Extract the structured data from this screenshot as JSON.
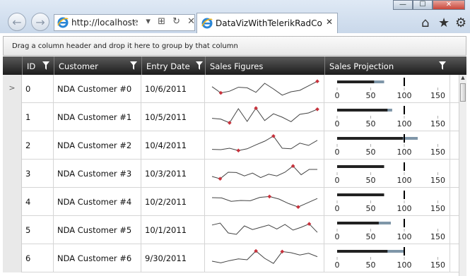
{
  "browser": {
    "address": "http://localhost:",
    "tab_title": "DataVizWithTelerikRadCont…",
    "back_glyph": "←",
    "forward_glyph": "→",
    "address_tools": "⌕ ▾ ⊞ ↻ ✕",
    "tab_close": "✕",
    "minimize": "—",
    "maximize": "☐",
    "close": "✕",
    "home_glyph": "⌂",
    "favorites_glyph": "★",
    "tools_glyph": "⚙",
    "ie_color": "#2a86d6"
  },
  "grid": {
    "group_panel_text": "Drag a column header and drop it here to group by that column",
    "headers": {
      "id": "ID",
      "customer": "Customer",
      "entry_date": "Entry Date",
      "sales_figures": "Sales Figures",
      "sales_projection": "Sales Projection"
    },
    "current_row_indicator": ">",
    "bullet_ticks": [
      "0",
      "50",
      "100",
      "150"
    ],
    "bullet_max": 160,
    "rows": [
      {
        "id": "0",
        "customer": "NDA Customer #0",
        "date": "10/6/2011",
        "spark": [
          48,
          26,
          32,
          46,
          44,
          28,
          60,
          40,
          18,
          30,
          35,
          51,
          67
        ],
        "marker": [
          1,
          12
        ],
        "actual": 55,
        "projected": 70,
        "target": 100
      },
      {
        "id": "1",
        "customer": "NDA Customer #1",
        "date": "10/5/2011",
        "spark": [
          36,
          33,
          20,
          70,
          25,
          72,
          28,
          52,
          40,
          24,
          50,
          55,
          68
        ],
        "marker": [
          2,
          5,
          12
        ],
        "actual": 75,
        "projected": 82,
        "target": 100
      },
      {
        "id": "2",
        "customer": "NDA Customer #2",
        "date": "10/4/2011",
        "spark": [
          26,
          25,
          30,
          22,
          28,
          42,
          55,
          73,
          30,
          28,
          48,
          40,
          58
        ],
        "marker": [
          3,
          7
        ],
        "actual": 98,
        "projected": 120,
        "target": 100
      },
      {
        "id": "3",
        "customer": "NDA Customer #3",
        "date": "10/3/2011",
        "spark": [
          30,
          22,
          45,
          44,
          32,
          42,
          26,
          38,
          32,
          45,
          67,
          36,
          55,
          55
        ],
        "marker": [
          1,
          10
        ],
        "actual": 70,
        "projected": 70,
        "target": 100
      },
      {
        "id": "4",
        "customer": "NDA Customer #4",
        "date": "10/2/2011",
        "spark": [
          55,
          54,
          42,
          45,
          44,
          56,
          59,
          50,
          34,
          22,
          37,
          52
        ],
        "marker": [
          6,
          9
        ],
        "actual": 70,
        "projected": 70,
        "target": 100
      },
      {
        "id": "5",
        "customer": "NDA Customer #5",
        "date": "10/1/2011",
        "spark": [
          58,
          65,
          30,
          25,
          55,
          42,
          50,
          58,
          44,
          60,
          40,
          50,
          62,
          32
        ],
        "marker": [
          12
        ],
        "actual": 62,
        "projected": 80,
        "target": 100
      },
      {
        "id": "6",
        "customer": "NDA Customer #6",
        "date": "9/30/2011",
        "spark": [
          30,
          24,
          32,
          38,
          35,
          66,
          40,
          22,
          64,
          60,
          52,
          58,
          46
        ],
        "marker": [
          5,
          8
        ],
        "actual": 75,
        "projected": 100,
        "target": 100
      }
    ],
    "colors": {
      "spark_line": "#444444",
      "spark_marker": "#c8323c",
      "bullet_actual": "#222222",
      "bullet_projected": "#7f96a8",
      "bullet_target": "#000000",
      "bullet_tick": "#b0b0b0",
      "bullet_label": "#222222"
    }
  }
}
